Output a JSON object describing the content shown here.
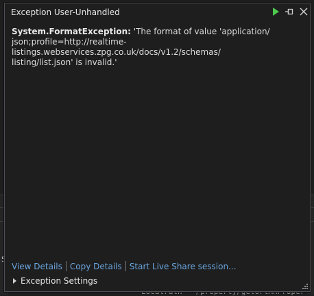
{
  "dialog": {
    "title": "Exception User-Unhandled",
    "exception_type": "System.FormatException:",
    "message_line1": " 'The format of value 'application/",
    "message_line2": "json;profile=http://realtime-listings.webservices.zpg.co.uk/docs/v1.2/schemas/",
    "message_line3": "listing/list.json' is invalid.'",
    "actions": {
      "view_details": "View Details",
      "copy_details": "Copy Details",
      "live_share": "Start Live Share session..."
    },
    "exception_settings": "Exception Settings"
  },
  "background": {
    "partial_letter": "S",
    "code_fragment": "Localrath = /property/getUrlAnProperty"
  },
  "colors": {
    "link": "#6aa6e0",
    "play": "#4ec94e",
    "background": "#1e1e1e"
  },
  "icons": [
    "play-icon",
    "pin-icon",
    "close-icon",
    "expand-arrow-icon",
    "resize-grip-icon"
  ]
}
